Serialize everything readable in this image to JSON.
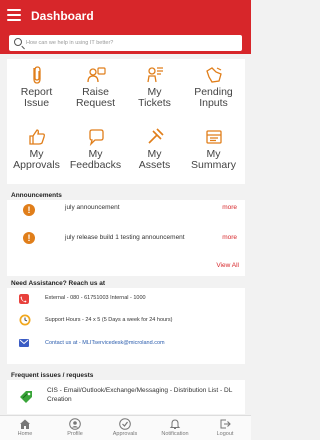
{
  "header": {
    "title": "Dashboard",
    "search_placeholder": "How can we help in using IT better?"
  },
  "tiles": [
    {
      "label": "Report\nIssue",
      "icon": "report-issue-icon"
    },
    {
      "label": "Raise\nRequest",
      "icon": "raise-request-icon"
    },
    {
      "label": "My\nTickets",
      "icon": "tickets-icon"
    },
    {
      "label": "Pending\nInputs",
      "icon": "pending-inputs-icon"
    },
    {
      "label": "My\nApprovals",
      "icon": "approvals-icon"
    },
    {
      "label": "My\nFeedbacks",
      "icon": "feedback-icon"
    },
    {
      "label": "My\nAssets",
      "icon": "assets-icon"
    },
    {
      "label": "My\nSummary",
      "icon": "summary-icon"
    }
  ],
  "announcements": {
    "title": "Announcements",
    "items": [
      {
        "text": "july announcement",
        "more": "more"
      },
      {
        "text": "july release build 1 testing announcement",
        "more": "more"
      }
    ],
    "view_all": "View All"
  },
  "assistance": {
    "title": "Need Assistance? Reach us at",
    "rows": [
      {
        "text": "External - 080 - 61751003 Internal - 1000",
        "icon": "phone-icon"
      },
      {
        "text": "Support Hours - 24 x 5 (5 Days a week for 24 hours)",
        "icon": "clock-icon"
      },
      {
        "text": "Contact us at - MLITservicedesk@microland.com",
        "icon": "mail-icon"
      }
    ]
  },
  "frequent": {
    "title": "Frequent issues / requests",
    "items": [
      {
        "text": "CIS - Email/Outlook/Exchange/Messaging - Distribution List - DL Creation",
        "icon": "tag-icon"
      }
    ]
  },
  "nav": [
    {
      "label": "Home",
      "icon": "home-icon"
    },
    {
      "label": "Profile",
      "icon": "profile-icon"
    },
    {
      "label": "Approvals",
      "icon": "approvals-nav-icon"
    },
    {
      "label": "Notification",
      "icon": "bell-icon"
    },
    {
      "label": "Logout",
      "icon": "logout-icon"
    }
  ],
  "colors": {
    "accent": "#d7262a",
    "icon_orange": "#e07e1a",
    "link_blue": "#2a5cad"
  }
}
